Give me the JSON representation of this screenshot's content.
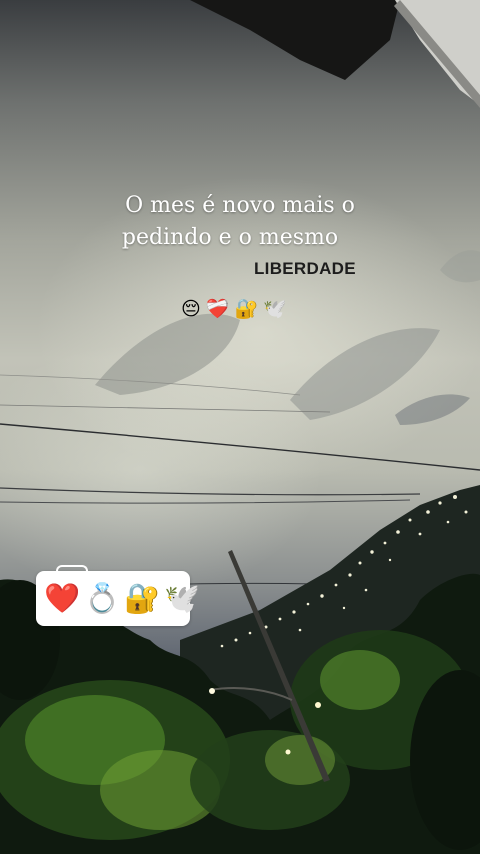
{
  "story": {
    "caption_line1": "O mes é novo mais o",
    "caption_line2": "pedindo e o mesmo",
    "tag": "LIBERDADE",
    "emoji_row": [
      {
        "glyph": "😔",
        "icon": "pensive-face-icon"
      },
      {
        "glyph": "❤️‍🩹",
        "icon": "mending-heart-icon"
      },
      {
        "glyph": "🔐",
        "icon": "locked-with-key-icon"
      },
      {
        "glyph": "🕊️",
        "icon": "dove-icon"
      }
    ],
    "sticker": [
      {
        "glyph": "❤️",
        "icon": "red-heart-icon"
      },
      {
        "glyph": "💍",
        "icon": "ring-icon"
      },
      {
        "glyph": "🔐",
        "icon": "locked-with-key-icon"
      },
      {
        "glyph": "🕊️",
        "icon": "dove-icon"
      }
    ]
  }
}
